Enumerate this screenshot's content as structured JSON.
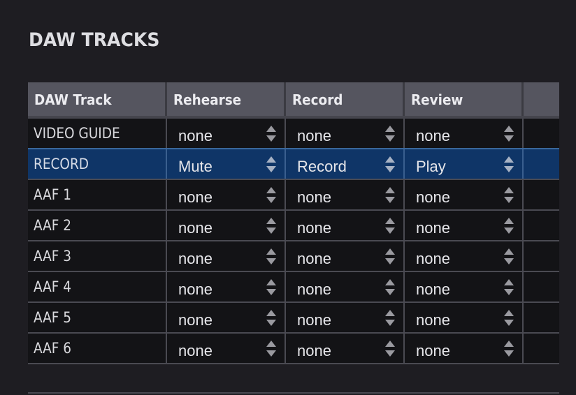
{
  "page": {
    "title": "DAW TRACKS"
  },
  "table": {
    "headers": [
      "DAW Track",
      "Rehearse",
      "Record",
      "Review",
      ""
    ],
    "selected_row_index": 1,
    "rows": [
      {
        "track": "VIDEO GUIDE",
        "rehearse": "none",
        "record": "none",
        "review": "none"
      },
      {
        "track": "RECORD",
        "rehearse": "Mute",
        "record": "Record",
        "review": "Play"
      },
      {
        "track": "AAF 1",
        "rehearse": "none",
        "record": "none",
        "review": "none"
      },
      {
        "track": "AAF 2",
        "rehearse": "none",
        "record": "none",
        "review": "none"
      },
      {
        "track": "AAF 3",
        "rehearse": "none",
        "record": "none",
        "review": "none"
      },
      {
        "track": "AAF 4",
        "rehearse": "none",
        "record": "none",
        "review": "none"
      },
      {
        "track": "AAF 5",
        "rehearse": "none",
        "record": "none",
        "review": "none"
      },
      {
        "track": "AAF 6",
        "rehearse": "none",
        "record": "none",
        "review": "none"
      }
    ]
  },
  "colors": {
    "background": "#1e1d22",
    "header_bg": "#55555f",
    "row_bg": "#131316",
    "selected_row_bg": "#0f3567",
    "grid_line": "#4a4a52"
  },
  "icons": {
    "stepper": "up-down-arrows-icon"
  }
}
